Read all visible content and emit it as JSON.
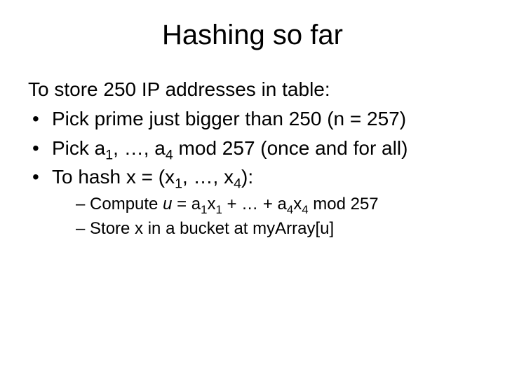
{
  "title": "Hashing so far",
  "lead": "To store 250 IP addresses in table:",
  "bullets": {
    "b1": "Pick prime just bigger than 250 (n = 257)",
    "b2_pre": "Pick a",
    "b2_s1": "1",
    "b2_mid": ", …, a",
    "b2_s4": "4",
    "b2_post": " mod 257 (once and for all)",
    "b3_pre": "To hash x = (x",
    "b3_s1": "1",
    "b3_mid": ", …, x",
    "b3_s4": "4",
    "b3_post": "):"
  },
  "sub": {
    "l1_pre": "– Compute ",
    "l1_u": "u",
    "l1_eq": " = a",
    "l1_s1": "1",
    "l1_x1": "x",
    "l1_s1b": "1",
    "l1_mid": " + … + a",
    "l1_s4": "4",
    "l1_x4": "x",
    "l1_s4b": "4",
    "l1_post": " mod 257",
    "l2": "– Store x in a bucket at myArray[u]"
  }
}
